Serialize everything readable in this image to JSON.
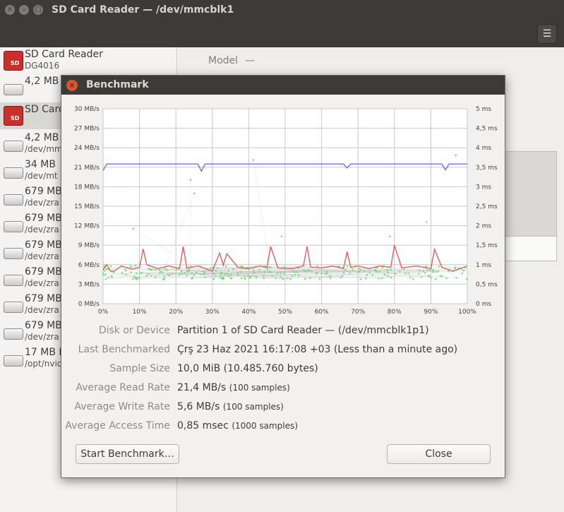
{
  "window": {
    "title": "SD Card Reader — /dev/mmcblk1",
    "close_glyph": "×",
    "min_glyph": "–",
    "max_glyph": "□",
    "menu_glyph": "☰"
  },
  "sidebar": {
    "items": [
      {
        "l1": "SD Card Reader",
        "l2": "DG4016",
        "icon": "sd-card-icon",
        "selected": false
      },
      {
        "l1": "4,2 MB",
        "l2": "",
        "icon": "disk-icon",
        "selected": false
      },
      {
        "l1": "SD Card",
        "l2": "",
        "icon": "sd-card-icon",
        "selected": true
      },
      {
        "l1": "4,2 MB",
        "l2": "/dev/mm",
        "icon": "disk-icon",
        "selected": false
      },
      {
        "l1": "34 MB",
        "l2": "/dev/mt",
        "icon": "disk-icon",
        "selected": false
      },
      {
        "l1": "679 MB",
        "l2": "/dev/zra",
        "icon": "disk-icon",
        "selected": false
      },
      {
        "l1": "679 MB",
        "l2": "/dev/zra",
        "icon": "disk-icon",
        "selected": false
      },
      {
        "l1": "679 MB",
        "l2": "/dev/zra",
        "icon": "disk-icon",
        "selected": false
      },
      {
        "l1": "679 MB",
        "l2": "/dev/zra",
        "icon": "disk-icon",
        "selected": false
      },
      {
        "l1": "679 MB",
        "l2": "/dev/zra",
        "icon": "disk-icon",
        "selected": false
      },
      {
        "l1": "679 MB",
        "l2": "/dev/zra",
        "icon": "disk-icon",
        "selected": false
      },
      {
        "l1": "17 MB L",
        "l2": "/opt/nvid",
        "icon": "disk-icon",
        "selected": false
      }
    ]
  },
  "main": {
    "model_label": "Model",
    "model_value": "—"
  },
  "dialog": {
    "title": "Benchmark",
    "close_glyph": "×",
    "rows": [
      {
        "key": "Disk or Device",
        "value": "Partition 1 of SD Card Reader — (/dev/mmcblk1p1)",
        "note": ""
      },
      {
        "key": "Last Benchmarked",
        "value": "Çrş 23 Haz 2021 16:17:08 +03 (Less than a minute ago)",
        "note": ""
      },
      {
        "key": "Sample Size",
        "value": "10,0 MiB (10.485.760 bytes)",
        "note": ""
      },
      {
        "key": "Average Read Rate",
        "value": "21,4 MB/s",
        "note": "(100 samples)"
      },
      {
        "key": "Average Write Rate",
        "value": "5,6 MB/s",
        "note": "(100 samples)"
      },
      {
        "key": "Average Access Time",
        "value": "0,85 msec",
        "note": "(1000 samples)"
      }
    ],
    "start_button": "Start Benchmark…",
    "close_button": "Close"
  },
  "chart_data": {
    "type": "line",
    "left_axis_ticks": [
      "0 MB/s",
      "3 MB/s",
      "6 MB/s",
      "9 MB/s",
      "12 MB/s",
      "15 MB/s",
      "18 MB/s",
      "21 MB/s",
      "24 MB/s",
      "27 MB/s",
      "30 MB/s"
    ],
    "right_axis_ticks": [
      "0 ms",
      "0,5 ms",
      "1 ms",
      "1,5 ms",
      "2 ms",
      "2,5 ms",
      "3 ms",
      "3,5 ms",
      "4 ms",
      "4,5 ms",
      "5 ms"
    ],
    "x_ticks": [
      "0%",
      "10%",
      "20%",
      "30%",
      "40%",
      "50%",
      "60%",
      "70%",
      "80%",
      "90%",
      "100%"
    ],
    "ylim_rate": [
      0,
      30
    ],
    "ylim_access": [
      0,
      5
    ],
    "xlim": [
      0,
      100
    ],
    "grid": true,
    "colors": {
      "read": "#7070ff",
      "write": "#e06060",
      "access": "#5de45d"
    },
    "series": [
      {
        "axis": "rate",
        "x": [
          0,
          1,
          5,
          10,
          20,
          26,
          27,
          28,
          40,
          60,
          66,
          67,
          68,
          80,
          93,
          94,
          95,
          100
        ],
        "values": [
          20.5,
          21.5,
          21.5,
          21.5,
          21.5,
          21.5,
          20.4,
          21.5,
          21.5,
          21.5,
          21.5,
          20.9,
          21.5,
          21.5,
          21.5,
          20.6,
          21.5,
          21.5
        ]
      },
      {
        "axis": "rate",
        "x": [
          0,
          1,
          2,
          3,
          5,
          8,
          10,
          11,
          12,
          15,
          18,
          21,
          22,
          23,
          26,
          30,
          32,
          33,
          34,
          37,
          40,
          43,
          45,
          46,
          48,
          52,
          55,
          56,
          57,
          60,
          63,
          66,
          67,
          68,
          70,
          73,
          76,
          79,
          80,
          82,
          86,
          90,
          91,
          93,
          96,
          100
        ],
        "values": [
          5.2,
          6.0,
          5.0,
          5.0,
          5.8,
          5.3,
          5.6,
          8.4,
          6.0,
          5.4,
          5.8,
          5.4,
          8.8,
          5.5,
          5.8,
          5.0,
          7.8,
          5.9,
          7.7,
          5.6,
          5.4,
          5.8,
          5.6,
          8.8,
          5.5,
          5.4,
          5.8,
          8.8,
          5.6,
          5.5,
          5.8,
          5.4,
          8.0,
          5.6,
          5.8,
          5.4,
          5.8,
          5.6,
          9.0,
          5.5,
          5.8,
          5.4,
          8.4,
          5.6,
          5.0,
          5.8
        ]
      }
    ]
  }
}
